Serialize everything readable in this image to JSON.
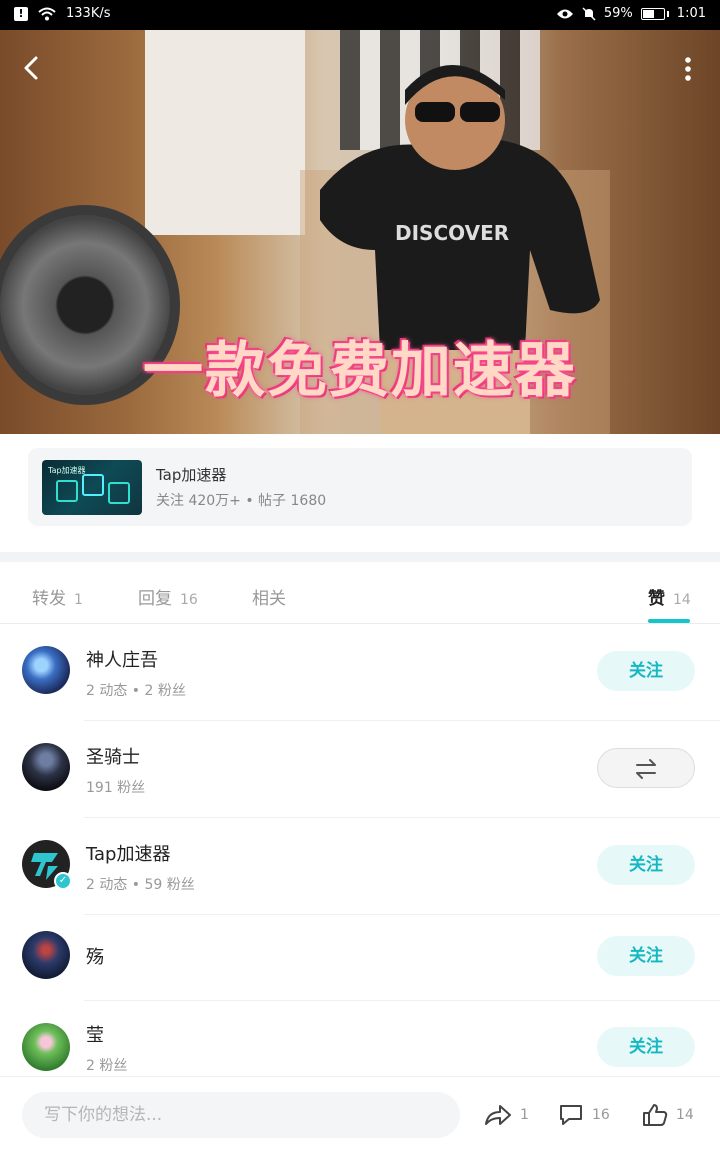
{
  "status_bar": {
    "network_speed": "133K/s",
    "battery_percent": "59%",
    "battery_level": 0.59,
    "time": "1:01"
  },
  "hero": {
    "caption": "一款免费加速器"
  },
  "app_card": {
    "thumb_label": "Tap加速器",
    "name": "Tap加速器",
    "meta": "关注 420万+ • 帖子 1680"
  },
  "tabs": [
    {
      "label": "转发",
      "count": "1"
    },
    {
      "label": "回复",
      "count": "16"
    },
    {
      "label": "相关",
      "count": ""
    },
    {
      "label": "赞",
      "count": "14"
    }
  ],
  "users": [
    {
      "name": "神人庄吾",
      "stats": "2 动态 • 2 粉丝",
      "button": "关注"
    },
    {
      "name": "圣骑士",
      "stats": "191 粉丝",
      "button": ""
    },
    {
      "name": "Tap加速器",
      "stats": "2 动态 • 59 粉丝",
      "button": "关注"
    },
    {
      "name": "殇",
      "stats": "",
      "button": "关注"
    },
    {
      "name": "莹",
      "stats": "2 粉丝",
      "button": "关注"
    }
  ],
  "bottom_bar": {
    "comment_placeholder": "写下你的想法...",
    "share_count": "1",
    "comment_count": "16",
    "like_count": "14"
  },
  "colors": {
    "accent": "#15c5ce",
    "follow_bg": "#e7f8f9"
  }
}
